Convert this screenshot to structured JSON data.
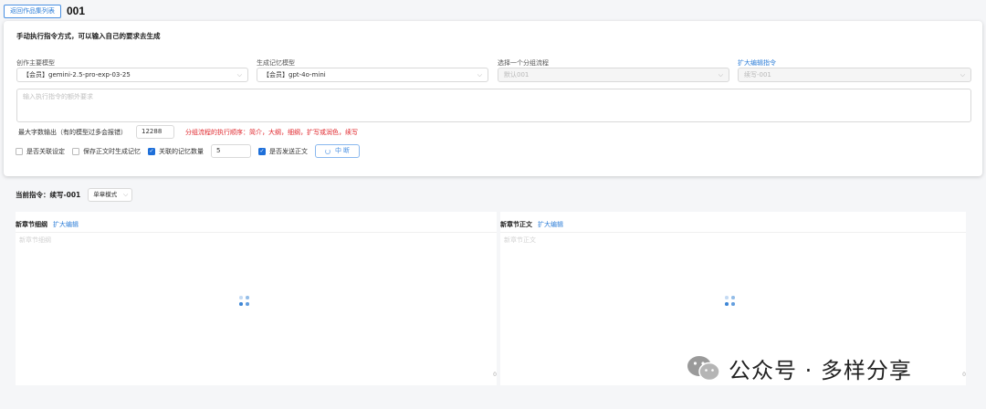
{
  "header": {
    "back_label": "返回作品集列表",
    "work_title": "001"
  },
  "card": {
    "title": "手动执行指令方式，可以输入自己的要求去生成",
    "fields": {
      "main_model": {
        "label": "创作主要模型",
        "value": "【会员】gemini-2.5-pro-exp-03-25"
      },
      "memory_model": {
        "label": "生成记忆模型",
        "value": "【会员】gpt-4o-mini"
      },
      "group_flow": {
        "label": "选择一个分组流程",
        "value": "默认001"
      },
      "expand_cmd": {
        "label": "扩大编辑指令",
        "value": "续写-001"
      }
    },
    "instruction_placeholder": "输入执行指令的额外要求",
    "max_output_label": "最大字数输出（有的模型过多会报错）",
    "max_output_value": "12288",
    "flow_hint": "分组流程的执行顺序：简介，大纲，细纲，扩写或润色，续写",
    "options": {
      "related_setting": "是否关联设定",
      "save_memory": "保存正文时生成记忆",
      "memory_count_label": "关联的记忆数量",
      "memory_count_value": "5",
      "send_body": "是否发送正文"
    },
    "stop_label": "中 断"
  },
  "current_command": {
    "label": "当前指令：续写-001",
    "mode": "单章模式"
  },
  "panels": {
    "outline": {
      "title": "新章节细纲",
      "link": "扩大编辑",
      "placeholder": "新章节细纲",
      "count": "0"
    },
    "body": {
      "title": "新章节正文",
      "link": "扩大编辑",
      "placeholder": "新章节正文",
      "count": "0"
    }
  },
  "watermark": {
    "text": "公众号 · 多样分享"
  },
  "colors": {
    "accent": "#1e6fd9",
    "link": "#2f7fd8",
    "warning": "#e0282e",
    "wechat_green": "#9a9a9a"
  },
  "icons": {
    "checkbox_checked": "check-icon",
    "loader": "loading-icon",
    "select": "chevron-down-icon"
  }
}
